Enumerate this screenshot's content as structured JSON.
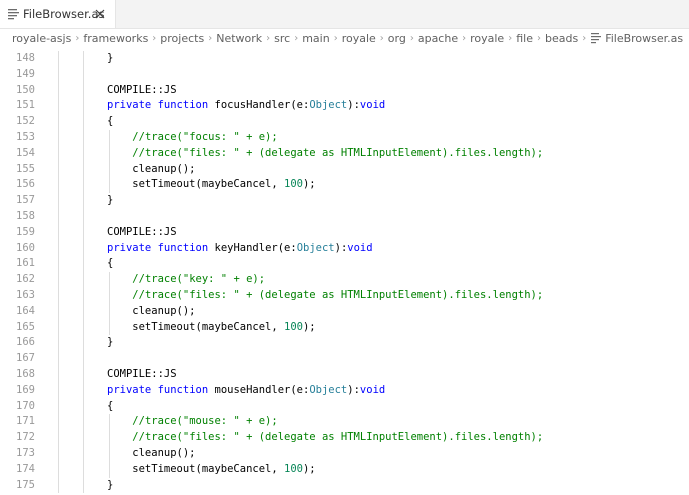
{
  "tab": {
    "label": "FileBrowser.as",
    "file_icon": "file-lines-icon",
    "close_icon": "close-icon"
  },
  "breadcrumb": [
    "royale-asjs",
    "frameworks",
    "projects",
    "Network",
    "src",
    "main",
    "royale",
    "org",
    "apache",
    "royale",
    "file",
    "beads",
    "FileBrowser.as"
  ],
  "lines": [
    {
      "n": "148",
      "text": "}"
    },
    {
      "n": "149",
      "text": ""
    },
    {
      "n": "150",
      "text": "COMPILE::JS"
    },
    {
      "n": "151",
      "text": "private function focusHandler(e:Object):void"
    },
    {
      "n": "152",
      "text": "{"
    },
    {
      "n": "153",
      "text": "    //trace(\"focus: \" + e);"
    },
    {
      "n": "154",
      "text": "    //trace(\"files: \" + (delegate as HTMLInputElement).files.length);"
    },
    {
      "n": "155",
      "text": "    cleanup();"
    },
    {
      "n": "156",
      "text": "    setTimeout(maybeCancel, 100);"
    },
    {
      "n": "157",
      "text": "}"
    },
    {
      "n": "158",
      "text": ""
    },
    {
      "n": "159",
      "text": "COMPILE::JS"
    },
    {
      "n": "160",
      "text": "private function keyHandler(e:Object):void"
    },
    {
      "n": "161",
      "text": "{"
    },
    {
      "n": "162",
      "text": "    //trace(\"key: \" + e);"
    },
    {
      "n": "163",
      "text": "    //trace(\"files: \" + (delegate as HTMLInputElement).files.length);"
    },
    {
      "n": "164",
      "text": "    cleanup();"
    },
    {
      "n": "165",
      "text": "    setTimeout(maybeCancel, 100);"
    },
    {
      "n": "166",
      "text": "}"
    },
    {
      "n": "167",
      "text": ""
    },
    {
      "n": "168",
      "text": "COMPILE::JS"
    },
    {
      "n": "169",
      "text": "private function mouseHandler(e:Object):void"
    },
    {
      "n": "170",
      "text": "{"
    },
    {
      "n": "171",
      "text": "    //trace(\"mouse: \" + e);"
    },
    {
      "n": "172",
      "text": "    //trace(\"files: \" + (delegate as HTMLInputElement).files.length);"
    },
    {
      "n": "173",
      "text": "    cleanup();"
    },
    {
      "n": "174",
      "text": "    setTimeout(maybeCancel, 100);"
    },
    {
      "n": "175",
      "text": "}"
    }
  ],
  "colors": {
    "keyword": "#af00db",
    "keyword_blue": "#0000ff",
    "function": "#795e26",
    "type": "#267f99",
    "comment": "#008000",
    "number": "#098658",
    "string": "#a31515",
    "line_number": "#999999"
  }
}
